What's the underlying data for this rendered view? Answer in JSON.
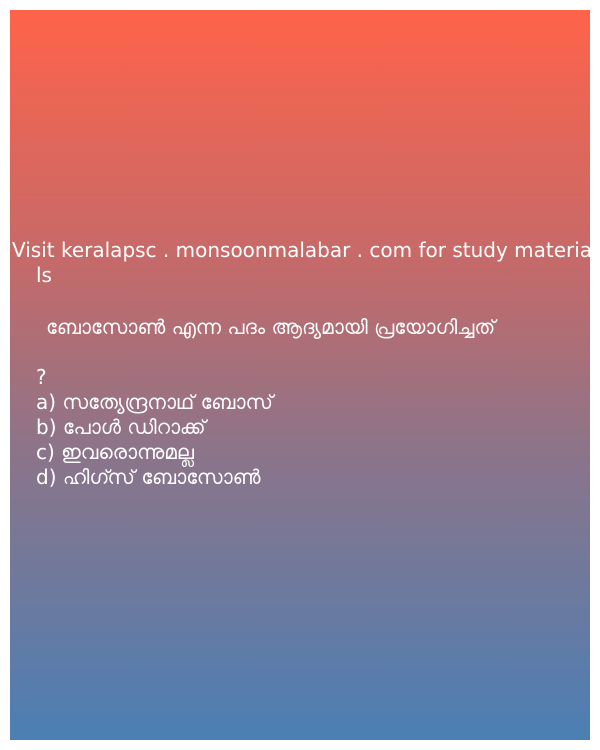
{
  "card": {
    "source_text": "Visit keralapsc . monsoonmalabar . com for study materia",
    "source_text_wrap": "ls",
    "question": "ബോസോൺ എന്ന പദം ആദ്യമായി പ്രയോഗിച്ചത്",
    "question_mark": "?",
    "options": [
      "a) സത്യേന്ദ്രനാഥ് ബോസ്",
      "b) പോൾ ഡിറാക്ക്",
      "c) ഇവരൊന്നുമല്ല",
      "d) ഹിഗ്സ് ബോസോൺ"
    ]
  },
  "colors": {
    "gradient_top": "#ff634a",
    "gradient_bottom": "#4b7fb4",
    "text": "#ffffff"
  }
}
